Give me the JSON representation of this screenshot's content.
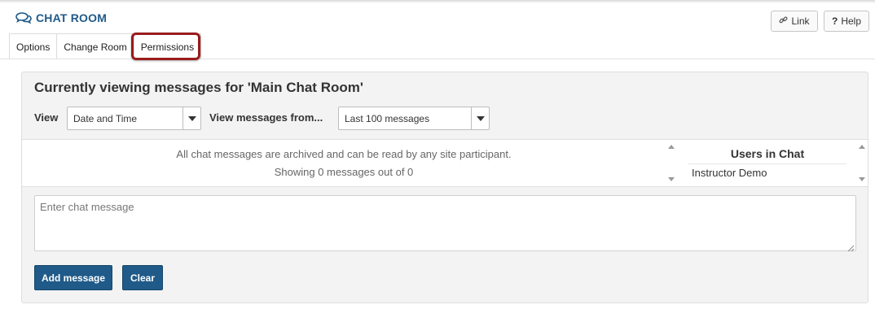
{
  "tool": {
    "title": "CHAT ROOM",
    "icon": "chat-bubbles-icon"
  },
  "top_buttons": {
    "link_label": "Link",
    "link_icon": "link-icon",
    "help_label": "Help",
    "help_icon": "question-icon"
  },
  "nav": {
    "items": [
      {
        "label": "Options"
      },
      {
        "label": "Change Room"
      },
      {
        "label": "Permissions"
      }
    ],
    "highlighted": "Permissions",
    "highlight_color": "#9a1b1b"
  },
  "panel": {
    "title": "Currently viewing messages for 'Main Chat Room'",
    "view_label": "View",
    "view_selected": "Date and Time",
    "from_label": "View messages from...",
    "from_selected": "Last 100 messages"
  },
  "messages": {
    "line1": "All chat messages are archived and can be read by any site participant.",
    "line2": "Showing 0 messages out of 0"
  },
  "users": {
    "header": "Users in Chat",
    "list": [
      "Instructor Demo"
    ]
  },
  "compose": {
    "placeholder": "Enter chat message",
    "value": "",
    "add_label": "Add message",
    "clear_label": "Clear"
  },
  "colors": {
    "brand": "#1f5a89",
    "panel_bg": "#f3f3f3"
  }
}
